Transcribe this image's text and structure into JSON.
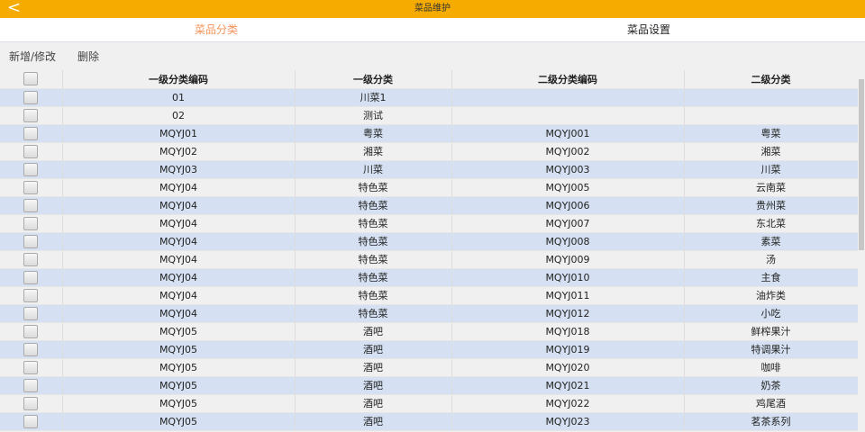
{
  "header": {
    "title": "菜品维护",
    "back": "<"
  },
  "tabs": [
    {
      "label": "菜品分类"
    },
    {
      "label": "菜品设置"
    }
  ],
  "toolbar": {
    "add_edit": "新增/修改",
    "delete": "删除"
  },
  "table": {
    "columns": [
      "一级分类编码",
      "一级分类",
      "二级分类编码",
      "二级分类"
    ],
    "rows": [
      [
        "01",
        "川菜1",
        "",
        ""
      ],
      [
        "02",
        "测试",
        "",
        ""
      ],
      [
        "MQYJ01",
        "粤菜",
        "MQYJ001",
        "粤菜"
      ],
      [
        "MQYJ02",
        "湘菜",
        "MQYJ002",
        "湘菜"
      ],
      [
        "MQYJ03",
        "川菜",
        "MQYJ003",
        "川菜"
      ],
      [
        "MQYJ04",
        "特色菜",
        "MQYJ005",
        "云南菜"
      ],
      [
        "MQYJ04",
        "特色菜",
        "MQYJ006",
        "贵州菜"
      ],
      [
        "MQYJ04",
        "特色菜",
        "MQYJ007",
        "东北菜"
      ],
      [
        "MQYJ04",
        "特色菜",
        "MQYJ008",
        "素菜"
      ],
      [
        "MQYJ04",
        "特色菜",
        "MQYJ009",
        "汤"
      ],
      [
        "MQYJ04",
        "特色菜",
        "MQYJ010",
        "主食"
      ],
      [
        "MQYJ04",
        "特色菜",
        "MQYJ011",
        "油炸类"
      ],
      [
        "MQYJ04",
        "特色菜",
        "MQYJ012",
        "小吃"
      ],
      [
        "MQYJ05",
        "酒吧",
        "MQYJ018",
        "鲜榨果汁"
      ],
      [
        "MQYJ05",
        "酒吧",
        "MQYJ019",
        "特调果汁"
      ],
      [
        "MQYJ05",
        "酒吧",
        "MQYJ020",
        "咖啡"
      ],
      [
        "MQYJ05",
        "酒吧",
        "MQYJ021",
        "奶茶"
      ],
      [
        "MQYJ05",
        "酒吧",
        "MQYJ022",
        "鸡尾酒"
      ],
      [
        "MQYJ05",
        "酒吧",
        "MQYJ023",
        "茗茶系列"
      ]
    ]
  }
}
